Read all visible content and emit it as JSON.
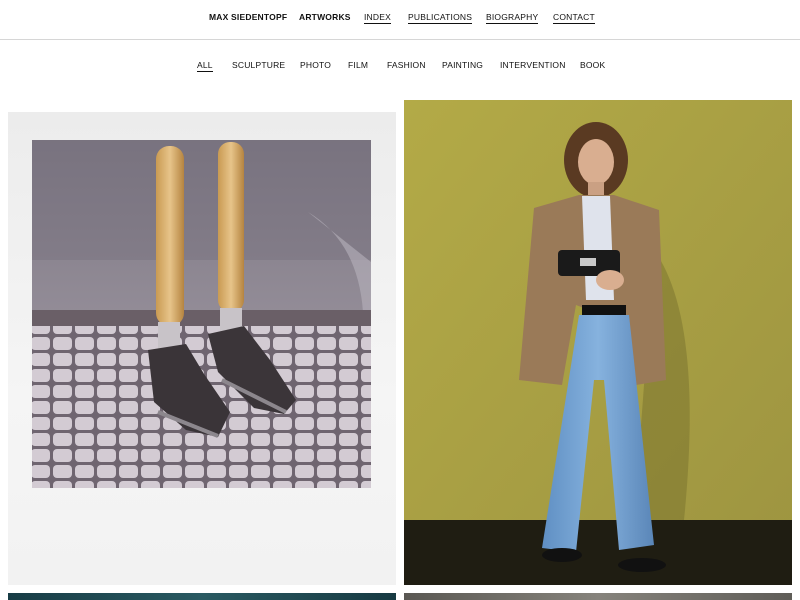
{
  "header": {
    "site_name": "MAX SIEDENTOPF",
    "nav": [
      {
        "label": "ARTWORKS"
      },
      {
        "label": "INDEX"
      },
      {
        "label": "PUBLICATIONS"
      },
      {
        "label": "BIOGRAPHY"
      },
      {
        "label": "CONTACT"
      }
    ]
  },
  "filters": {
    "items": [
      {
        "label": "ALL",
        "active": true
      },
      {
        "label": "SCULPTURE"
      },
      {
        "label": "PHOTO"
      },
      {
        "label": "FILM"
      },
      {
        "label": "FASHION"
      },
      {
        "label": "PAINTING"
      },
      {
        "label": "INTERVENTION"
      },
      {
        "label": "BOOK"
      }
    ]
  },
  "gallery": {
    "tiles": [
      {
        "description_icon": "polaroid-baguette-legs-image"
      },
      {
        "description_icon": "fashion-model-olive-background-image"
      },
      {
        "description_icon": "teal-image-partial"
      },
      {
        "description_icon": "grey-image-partial"
      }
    ]
  },
  "colors": {
    "text": "#111111",
    "divider": "#d6d6d6",
    "olive_background": "#aaa244"
  }
}
